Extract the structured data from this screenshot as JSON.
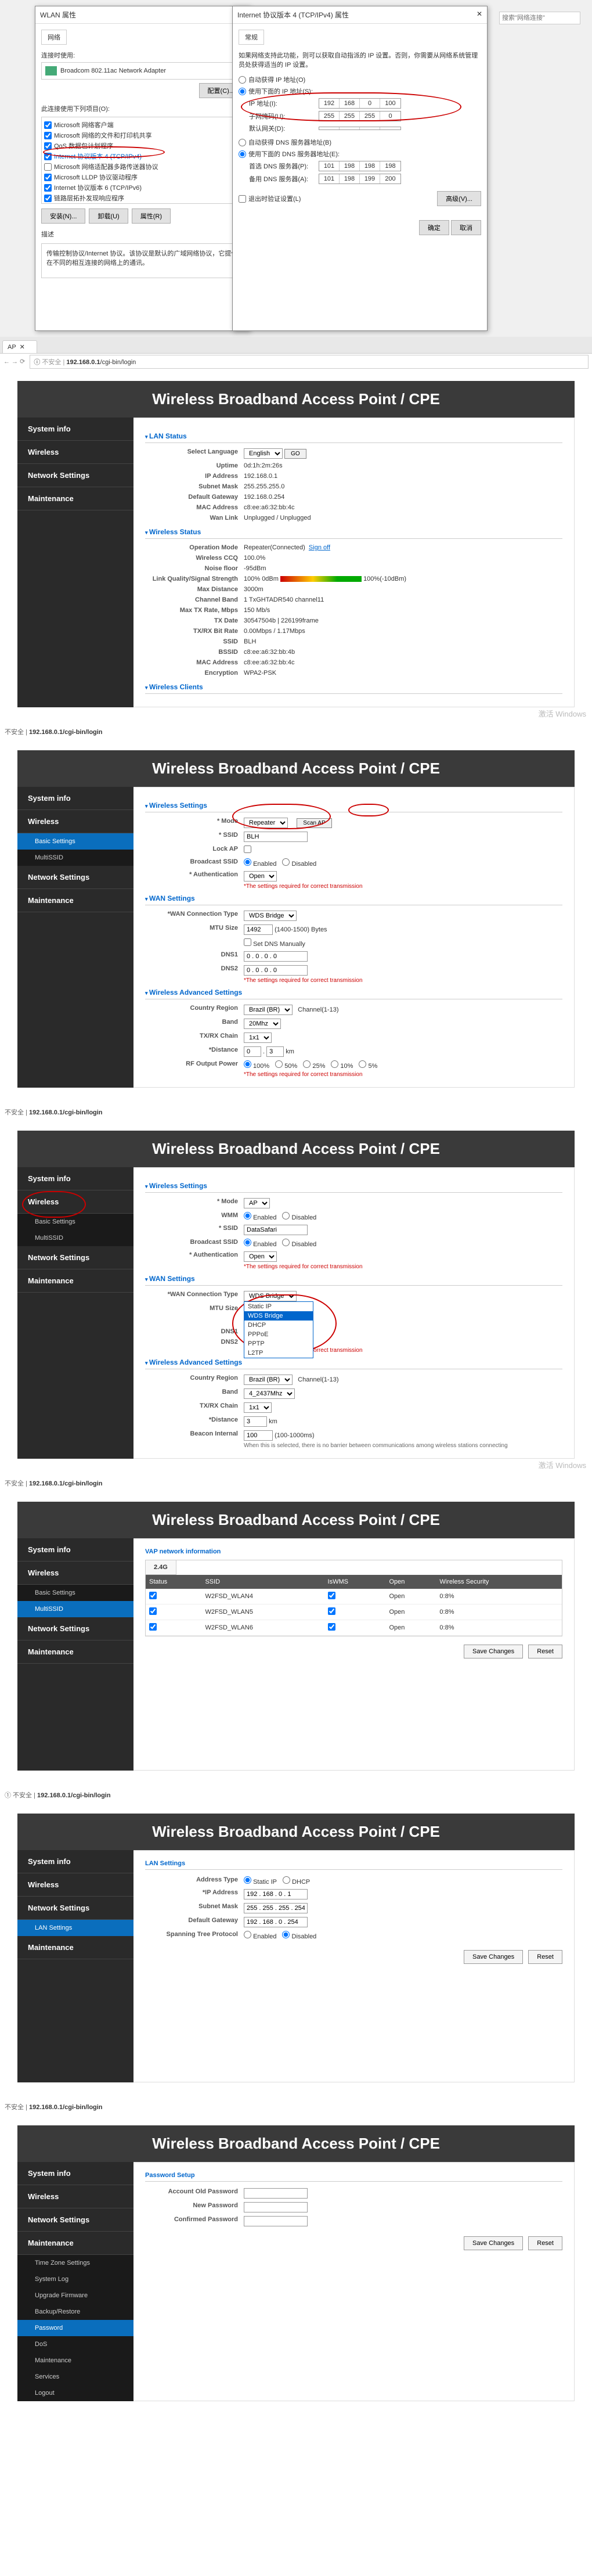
{
  "win": {
    "dlg1_title": "WLAN 属性",
    "dlg2_title": "Internet 协议版本 4 (TCP/IPv4) 属性",
    "tab_net": "网络",
    "tab_gen": "常规",
    "conn_label": "连接时使用:",
    "adapter": "Broadcom 802.11ac Network Adapter",
    "config_btn": "配置(C)...",
    "proto_label": "此连接使用下列项目(O):",
    "protos": [
      "Microsoft 网络客户端",
      "Microsoft 网络的文件和打印机共享",
      "QoS 数据包计划程序",
      "Internet 协议版本 4 (TCP/IPv4)",
      "Microsoft 网络适配器多路传送器协议",
      "Microsoft LLDP 协议驱动程序",
      "Internet 协议版本 6 (TCP/IPv6)",
      "链路层拓扑发现响应程序"
    ],
    "install": "安装(N)...",
    "uninstall": "卸载(U)",
    "props": "属性(R)",
    "desc_h": "描述",
    "desc": "传输控制协议/Internet 协议。该协议是默认的广域网络协议，它提供在不同的相互连接的网络上的通讯。",
    "ip_intro": "如果网络支持此功能，则可以获取自动指派的 IP 设置。否则，你需要从网络系统管理员处获得适当的 IP 设置。",
    "auto_ip": "自动获得 IP 地址(O)",
    "use_ip": "使用下面的 IP 地址(S):",
    "ip_l": "IP 地址(I):",
    "mask_l": "子网掩码(U):",
    "gw_l": "默认网关(D):",
    "ip_v": [
      "192",
      "168",
      "0",
      "100"
    ],
    "mask_v": [
      "255",
      "255",
      "255",
      "0"
    ],
    "gw_v": [
      "",
      "",
      "",
      ""
    ],
    "auto_dns": "自动获得 DNS 服务器地址(B)",
    "use_dns": "使用下面的 DNS 服务器地址(E):",
    "dns1_l": "首选 DNS 服务器(P):",
    "dns2_l": "备用 DNS 服务器(A):",
    "dns1_v": [
      "101",
      "198",
      "198",
      "198"
    ],
    "dns2_v": [
      "101",
      "198",
      "199",
      "200"
    ],
    "exit_val": "退出时验证设置(L)",
    "adv": "高级(V)...",
    "ok": "确定",
    "cancel": "取消",
    "search_placeholder": "搜索\"网络连接\""
  },
  "browser": {
    "tab": "AP",
    "addr_prefix": "不安全 |",
    "addr": "192.168.0.1/cgi-bin/login",
    "addr_short": "192.168.0.1"
  },
  "cpe": {
    "title": "Wireless Broadband Access Point / CPE",
    "nav": {
      "sys": "System info",
      "wl": "Wireless",
      "net": "Network Settings",
      "mnt": "Maintenance"
    },
    "sub": {
      "basic": "Basic Settings",
      "multi": "MultiSSID",
      "lan": "LAN Settings",
      "tz": "Time Zone Settings",
      "log": "System Log",
      "upg": "Upgrade Firmware",
      "bak": "Backup/Restore",
      "pwd": "Password",
      "ddt": "DoS",
      "m2": "Maintenance",
      "svc": "Services",
      "logout": "Logout"
    }
  },
  "status": {
    "sec_lan": "LAN Status",
    "sec_wl": "Wireless Status",
    "sec_cli": "Wireless Clients",
    "sel_lang_l": "Select Language",
    "sel_lang": "English",
    "go": "GO",
    "rows": [
      [
        "Uptime",
        "0d:1h:2m:26s"
      ],
      [
        "IP Address",
        "192.168.0.1"
      ],
      [
        "Subnet Mask",
        "255.255.255.0"
      ],
      [
        "Default Gateway",
        "192.168.0.254"
      ],
      [
        "MAC Address",
        "c8:ee:a6:32:bb:4c"
      ],
      [
        "Wan Link",
        "Unplugged / Unplugged"
      ]
    ],
    "wrows": [
      [
        "Operation Mode",
        "Repeater(Connected)"
      ],
      [
        "Wireless CCQ",
        "100.0%"
      ],
      [
        "Noise floor",
        "-95dBm"
      ],
      [
        "Link Quality/Signal Strength",
        "100% 0dBm"
      ],
      [
        "Max Distance",
        "3000m"
      ],
      [
        "Channel Band",
        "1 TxGHTADR540   channel11"
      ],
      [
        "Max TX Rate, Mbps",
        "150 Mb/s"
      ],
      [
        "TX Date",
        "30547504b | 226199frame"
      ],
      [
        "TX/RX Bit Rate",
        "0.00Mbps / 1.17Mbps"
      ],
      [
        "SSID",
        "BLH"
      ],
      [
        "BSSID",
        "c8:ee:a6:32:bb:4b"
      ],
      [
        "MAC Address",
        "c8:ee:a6:32:bb:4c"
      ],
      [
        "Encryption",
        "WPA2-PSK"
      ]
    ],
    "signoff": "Sign off",
    "sig_labels": "100%(-10dBm)"
  },
  "basic": {
    "sec_wl": "Wireless Settings",
    "sec_wan": "WAN Settings",
    "sec_adv": "Wireless Advanced Settings",
    "mode_l": "* Mode",
    "mode_v": "Repeater",
    "scan": "Scan AP",
    "ssid_l": "* SSID",
    "ssid_v": "BLH",
    "lock_l": "Lock AP",
    "bcast_l": "Broadcast SSID",
    "opt_en": "Enabled",
    "opt_dis": "Disabled",
    "auth_l": "* Authentication",
    "auth_v": "Open",
    "req": "*The settings required for correct transmission",
    "wan_l": "*WAN Connection Type",
    "wan_v": "WDS Bridge",
    "mtu_l": "MTU Size",
    "mtu_v": "1492",
    "mtu_suf": "(1400-1500) Bytes",
    "dns_man": "Set DNS Manually",
    "dns1_l": "DNS1",
    "dns2_l": "DNS2",
    "dns_v": "0 . 0 . 0 . 0",
    "region_l": "Country Region",
    "region_v": "Brazil (BR)",
    "chan_l": "Channel(1-13)",
    "band_l": "Band",
    "band_v": "20Mhz",
    "txrx_l": "TX/RX Chain",
    "txrx_v": "1x1",
    "dist_l": "*Distance",
    "dist_a": "0",
    "dist_b": "3",
    "dist_u": "km",
    "rf_l": "RF Output Power",
    "rf_opts": [
      "100%",
      "50%",
      "25%",
      "10%",
      "5%"
    ]
  },
  "basic2": {
    "mode_v": "AP",
    "wmm_l": "WMM",
    "ssid_v": "DataSafari",
    "wan_v": "WDS Bridge",
    "dd_opts": [
      "Static IP",
      "WDS Bridge",
      "DHCP",
      "PPPoE",
      "PPTP",
      "L2TP"
    ],
    "band_v": "4_2437Mhz",
    "txrx_v": "1x1",
    "dist_v": "3",
    "dist_u": "km",
    "beacon_l": "Beacon Internal",
    "beacon_v": "100",
    "beacon_suf": "(100-1000ms)",
    "note": "When this is selected, there is no barrier between communications among wireless stations connecting"
  },
  "vap": {
    "head": "VAP network information",
    "tab": "2.4G",
    "cols": [
      "Status",
      "SSID",
      "IsWMS",
      "Open",
      "Wireless Security"
    ],
    "rows": [
      [
        "W2FSD_WLAN4",
        "Open",
        "0:8%"
      ],
      [
        "W2FSD_WLAN5",
        "Open",
        "0:8%"
      ],
      [
        "W2FSD_WLAN6",
        "Open",
        "0:8%"
      ]
    ],
    "save": "Save Changes",
    "reset": "Reset"
  },
  "lan": {
    "sec": "LAN Settings",
    "addr_type_l": "Address Type",
    "opt_static": "Static IP",
    "opt_dhcp": "DHCP",
    "ip_l": "*IP Address",
    "ip_v": "192 . 168 . 0 . 1",
    "mask_l": "Subnet Mask",
    "mask_v": "255 . 255 . 255 . 254",
    "gw_l": "Default Gateway",
    "gw_v": "192 . 168 . 0 . 254",
    "stp_l": "Spanning Tree Protocol",
    "save": "Save Changes",
    "reset": "Reset"
  },
  "pwd": {
    "sec": "Password Setup",
    "old_l": "Account Old Password",
    "new_l": "New Password",
    "conf_l": "Confirmed Password",
    "save": "Save Changes",
    "reset": "Reset"
  },
  "wm": "激活 Windows"
}
